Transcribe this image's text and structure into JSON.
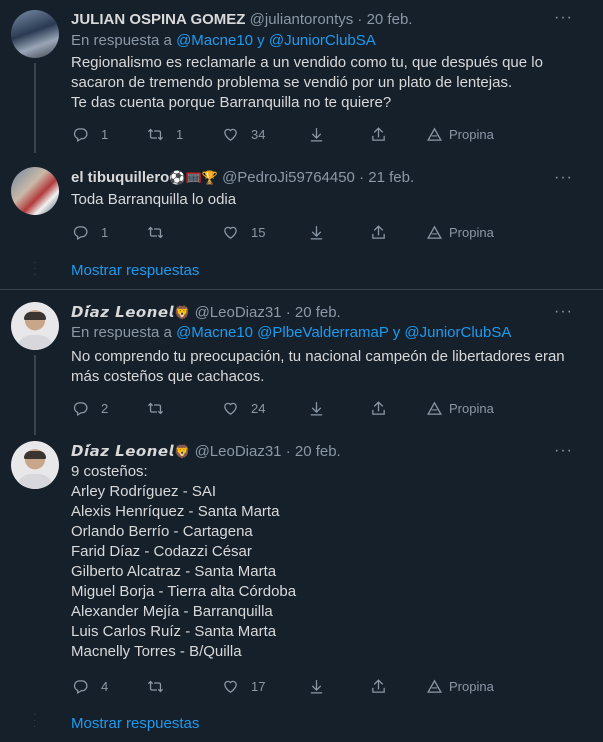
{
  "tweets": [
    {
      "name": "JULIAN OSPINA GOMEZ",
      "handle": "@juliantorontys",
      "date": "· 20 feb.",
      "reply_prefix": "En respuesta a",
      "reply_to": "@Macne10 y @JuniorClubSA",
      "body": "Regionalismo es reclamarle a un vendido como tu, que después que lo\nsacaron de tremendo problema se vendió por un plato de lentejas.\nTe das cuenta porque Barranquilla no te quiere?",
      "replies": "1",
      "retweets": "1",
      "likes": "34",
      "tip": "Propina"
    },
    {
      "name": "el tibuquillero",
      "name_emojis": "⚽🥅🏆",
      "handle": "@PedroJi59764450",
      "date": "· 21 feb.",
      "body": "Toda Barranquilla lo odia",
      "replies": "1",
      "retweets": "",
      "likes": "15",
      "tip": "Propina"
    },
    {
      "name": "𝘿𝙞́𝙖𝙯 𝙇𝙚𝙤𝙣𝙚𝙡",
      "name_emojis": "🦁",
      "handle": "@LeoDiaz31",
      "date": "· 20 feb.",
      "reply_prefix": "En respuesta a",
      "reply_to": "@Macne10 @PlbeValderramaP y @JuniorClubSA",
      "body": "No comprendo tu preocupación, tu nacional campeón de libertadores eran\nmás costeños que cachacos.",
      "replies": "2",
      "retweets": "",
      "likes": "24",
      "tip": "Propina"
    },
    {
      "name": "𝘿𝙞́𝙖𝙯 𝙇𝙚𝙤𝙣𝙚𝙡",
      "name_emojis": "🦁",
      "handle": "@LeoDiaz31",
      "date": "· 20 feb.",
      "body": "9 costeños:\nArley Rodríguez - SAI\nAlexis Henríquez - Santa Marta\nOrlando Berrío - Cartagena\nFarid Díaz - Codazzi César\nGilberto Alcatraz - Santa Marta\nMiguel Borja - Tierra alta Córdoba\nAlexander Mejía - Barranquilla\nLuis Carlos Ruíz - Santa Marta\nMacnelly Torres - B/Quilla",
      "replies": "4",
      "retweets": "",
      "likes": "17",
      "tip": "Propina"
    }
  ],
  "show_replies_label": "Mostrar respuestas",
  "more_glyph": "···",
  "colors": {
    "background": "#15202b",
    "link": "#1d9bf0",
    "muted": "#8b98a5",
    "divider": "#38444d"
  }
}
